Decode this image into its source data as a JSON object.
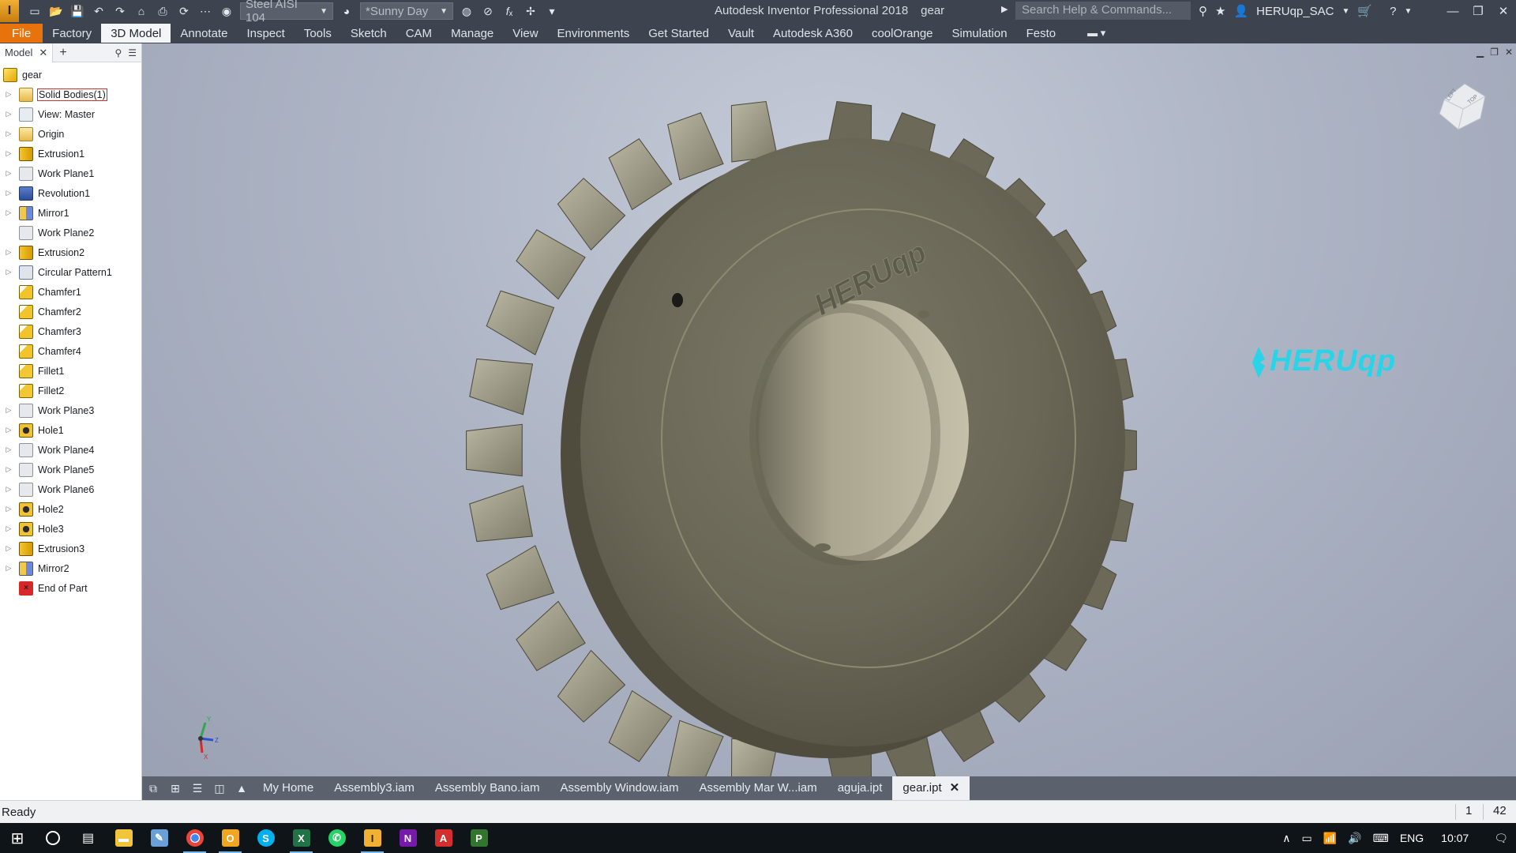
{
  "app": {
    "logo_letter": "I",
    "material": "Steel AISI 104",
    "appearance": "*Sunny Day",
    "title": "Autodesk Inventor Professional 2018",
    "document": "gear",
    "search_placeholder": "Search Help & Commands...",
    "user": "HERUqp_SAC",
    "brand_color": "#e8720c"
  },
  "ribbon": {
    "tabs": [
      "File",
      "Factory",
      "3D Model",
      "Annotate",
      "Inspect",
      "Tools",
      "Sketch",
      "CAM",
      "Manage",
      "View",
      "Environments",
      "Get Started",
      "Vault",
      "Autodesk A360",
      "coolOrange",
      "Simulation",
      "Festo"
    ],
    "active": "3D Model"
  },
  "browser": {
    "tab_label": "Model",
    "root": "gear",
    "nodes": [
      {
        "label": "Solid Bodies(1)",
        "icon": "folder-icon",
        "expandable": true,
        "selected": true
      },
      {
        "label": "View: Master",
        "icon": "view-icon",
        "expandable": true
      },
      {
        "label": "Origin",
        "icon": "folder-icon",
        "expandable": true
      },
      {
        "label": "Extrusion1",
        "icon": "extrude-icon",
        "expandable": true
      },
      {
        "label": "Work Plane1",
        "icon": "work-plane-icon",
        "expandable": true
      },
      {
        "label": "Revolution1",
        "icon": "revolve-icon",
        "expandable": true
      },
      {
        "label": "Mirror1",
        "icon": "mirror-icon",
        "expandable": true
      },
      {
        "label": "Work Plane2",
        "icon": "work-plane-icon",
        "expandable": false
      },
      {
        "label": "Extrusion2",
        "icon": "extrude-icon",
        "expandable": true
      },
      {
        "label": "Circular Pattern1",
        "icon": "circular-pattern-icon",
        "expandable": true
      },
      {
        "label": "Chamfer1",
        "icon": "chamfer-icon",
        "expandable": false
      },
      {
        "label": "Chamfer2",
        "icon": "chamfer-icon",
        "expandable": false
      },
      {
        "label": "Chamfer3",
        "icon": "chamfer-icon",
        "expandable": false
      },
      {
        "label": "Chamfer4",
        "icon": "chamfer-icon",
        "expandable": false
      },
      {
        "label": "Fillet1",
        "icon": "fillet-icon",
        "expandable": false
      },
      {
        "label": "Fillet2",
        "icon": "fillet-icon",
        "expandable": false
      },
      {
        "label": "Work Plane3",
        "icon": "work-plane-icon",
        "expandable": true
      },
      {
        "label": "Hole1",
        "icon": "hole-icon",
        "expandable": true
      },
      {
        "label": "Work Plane4",
        "icon": "work-plane-icon",
        "expandable": true
      },
      {
        "label": "Work Plane5",
        "icon": "work-plane-icon",
        "expandable": true
      },
      {
        "label": "Work Plane6",
        "icon": "work-plane-icon",
        "expandable": true
      },
      {
        "label": "Hole2",
        "icon": "hole-icon",
        "expandable": true
      },
      {
        "label": "Hole3",
        "icon": "hole-icon",
        "expandable": true
      },
      {
        "label": "Extrusion3",
        "icon": "extrude-icon",
        "expandable": true
      },
      {
        "label": "Mirror2",
        "icon": "mirror-icon",
        "expandable": true
      },
      {
        "label": "End of Part",
        "icon": "end-of-part-icon",
        "expandable": false
      }
    ]
  },
  "viewport": {
    "watermark": "HERUqp",
    "watermark_color": "#2ad4e8",
    "engraving": "HERUqp",
    "viewcube_faces": [
      "LEFT",
      "TOP"
    ],
    "axis_labels": [
      "Y",
      "Z",
      "X"
    ]
  },
  "doc_tabs": {
    "items": [
      "My Home",
      "Assembly3.iam",
      "Assembly Bano.iam",
      "Assembly Window.iam",
      "Assembly Mar W...iam",
      "aguja.ipt",
      "gear.ipt"
    ],
    "active": "gear.ipt"
  },
  "status": {
    "message": "Ready",
    "count1": "1",
    "count2": "42"
  },
  "taskbar": {
    "language": "ENG",
    "time": "10:07"
  }
}
